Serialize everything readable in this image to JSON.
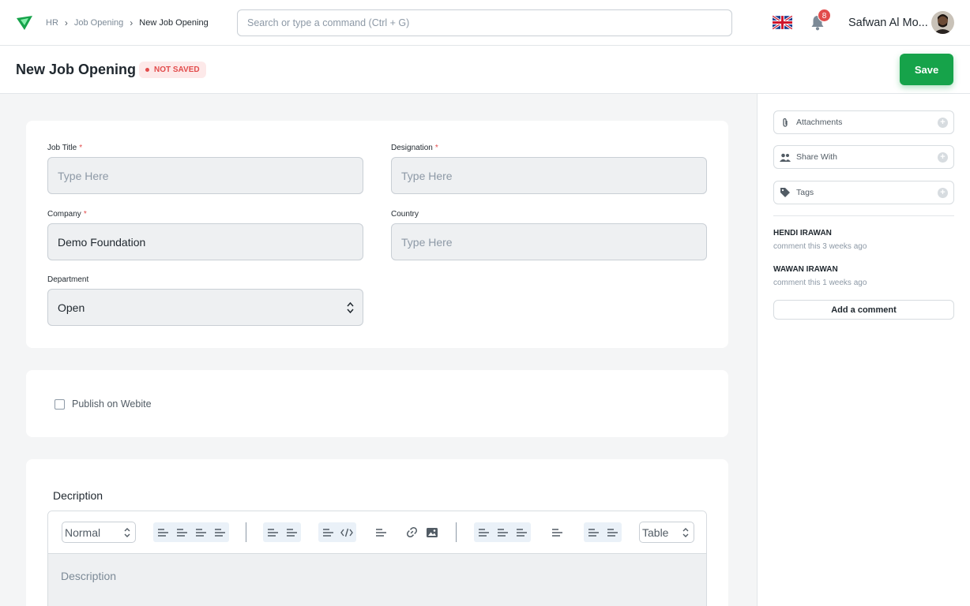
{
  "nav": {
    "breadcrumbs": [
      "HR",
      "Job Opening",
      "New Job Opening"
    ],
    "search_placeholder": "Search or type a command (Ctrl + G)",
    "notification_count": "8",
    "user_name": "Safwan Al Mo..."
  },
  "page": {
    "title": "New Job Opening",
    "status": "NOT SAVED",
    "save_label": "Save"
  },
  "form": {
    "job_title": {
      "label": "Job Title",
      "placeholder": "Type Here"
    },
    "designation": {
      "label": "Designation",
      "placeholder": "Type Here"
    },
    "company": {
      "label": "Company",
      "value": "Demo Foundation"
    },
    "country": {
      "label": "Country",
      "placeholder": "Type Here"
    },
    "department": {
      "label": "Department",
      "value": "Open"
    },
    "publish_label": "Publish on Webite",
    "description": {
      "title": "Decription",
      "placeholder": "Description",
      "format_select": "Normal",
      "table_select": "Table"
    }
  },
  "sidebar": {
    "attachments": "Attachments",
    "share_with": "Share With",
    "tags": "Tags",
    "comments": [
      {
        "name": "HENDI IRAWAN",
        "time": "comment this 3 weeks ago"
      },
      {
        "name": "WAWAN IRAWAN",
        "time": "comment this 1 weeks ago"
      }
    ],
    "add_comment": "Add a comment"
  },
  "colors": {
    "primary": "#16a34a",
    "danger": "#e24c4c",
    "toolbar_group": "#eaf1f8"
  }
}
